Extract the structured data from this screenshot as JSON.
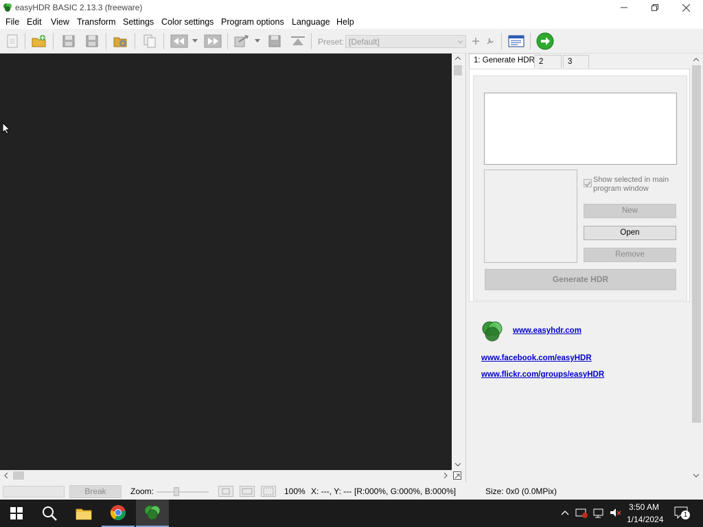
{
  "window": {
    "title": "easyHDR BASIC 2.13.3 (freeware)"
  },
  "menu": [
    "File",
    "Edit",
    "View",
    "Transform",
    "Settings",
    "Color settings",
    "Program options",
    "Language",
    "Help"
  ],
  "toolbar": {
    "preset_label": "Preset:",
    "preset_value": "[Default]"
  },
  "tabs": [
    "1: Generate HDR",
    "2",
    "3"
  ],
  "panel": {
    "show_selected_label": "Show selected in main program window",
    "new_label": "New",
    "open_label": "Open",
    "remove_label": "Remove",
    "generate_label": "Generate HDR",
    "link_site": "www.easyhdr.com",
    "link_facebook": "www.facebook.com/easyHDR",
    "link_flickr": "www.flickr.com/groups/easyHDR"
  },
  "status": {
    "break_label": "Break",
    "zoom_label": "Zoom:",
    "zoom_value": "100%",
    "coords": "X: ---, Y: ---",
    "rgb": "[R:000%, G:000%, B:000%]",
    "size": "Size: 0x0 (0.0MPix)"
  },
  "taskbar": {
    "time": "3:50 AM",
    "date": "1/14/2024",
    "notification_count": "1"
  },
  "colors": {
    "canvas_bg": "#222222",
    "taskbar_bg": "#1b1b1b",
    "link": "#0000cc",
    "go_green": "#2eaa2e"
  }
}
